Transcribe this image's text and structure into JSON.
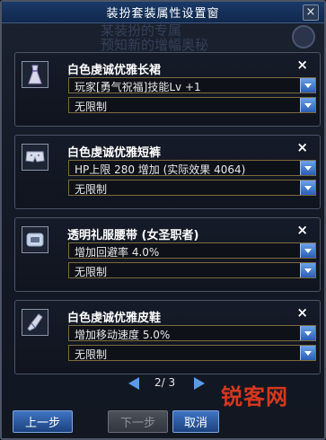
{
  "window": {
    "title": "装扮套装属性设置窗",
    "close_label": "×"
  },
  "background_text": {
    "line1": "某装扮的专属",
    "line2": "预知新的增幅奥秘"
  },
  "items": [
    {
      "name": "白色虔诚优雅长裙",
      "icon": "dress-icon",
      "option1": "玩家[勇气祝福]技能Lv +1",
      "option2": "无限制",
      "close_label": "×"
    },
    {
      "name": "白色虔诚优雅短裤",
      "icon": "shorts-icon",
      "option1": "HP上限 280 增加 (实际效果 4064)",
      "option2": "无限制",
      "close_label": "×"
    },
    {
      "name": "透明礼服腰带 (女圣职者)",
      "icon": "belt-icon",
      "option1": "增加回避率 4.0%",
      "option2": "无限制",
      "close_label": "×"
    },
    {
      "name": "白色虔诚优雅皮鞋",
      "icon": "shoe-icon",
      "option1": "增加移动速度 5.0%",
      "option2": "无限制",
      "close_label": "×"
    }
  ],
  "pagination": {
    "text": "2/ 3"
  },
  "buttons": {
    "prev": "上一步",
    "next": "下一步",
    "cancel": "取消"
  },
  "watermark": "锐客网",
  "colors": {
    "accent_blue": "#3f73c2",
    "watermark_red": "#e03a1e",
    "dropdown_border": "#7d6b3e"
  }
}
